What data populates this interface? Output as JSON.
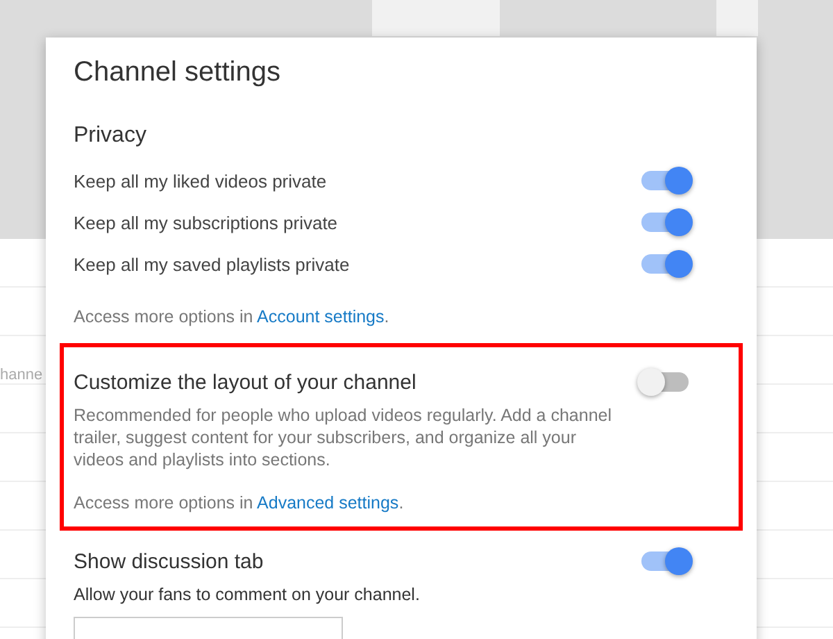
{
  "background": {
    "label": "hanne"
  },
  "dialog": {
    "title": "Channel settings",
    "sections": [
      {
        "kind": "group",
        "heading": "Privacy",
        "toggles": [
          {
            "label": "Keep all my liked videos private",
            "on": true
          },
          {
            "label": "Keep all my subscriptions private",
            "on": true
          },
          {
            "label": "Keep all my saved playlists private",
            "on": true
          }
        ],
        "note": {
          "text": "Access more options in",
          "link": "Account settings",
          "suffix": "."
        }
      },
      {
        "kind": "feature",
        "heading": "Customize the layout of your channel",
        "on": false,
        "highlighted": true,
        "description": "Recommended for people who upload videos regularly. Add a channel trailer, suggest content for your subscribers, and organize all your videos and playlists into sections.",
        "note": {
          "text": "Access more options in",
          "link": "Advanced settings",
          "suffix": "."
        }
      },
      {
        "kind": "feature",
        "heading": "Show discussion tab",
        "on": true,
        "description": "Allow your fans to comment on your channel.",
        "field": true
      }
    ]
  }
}
